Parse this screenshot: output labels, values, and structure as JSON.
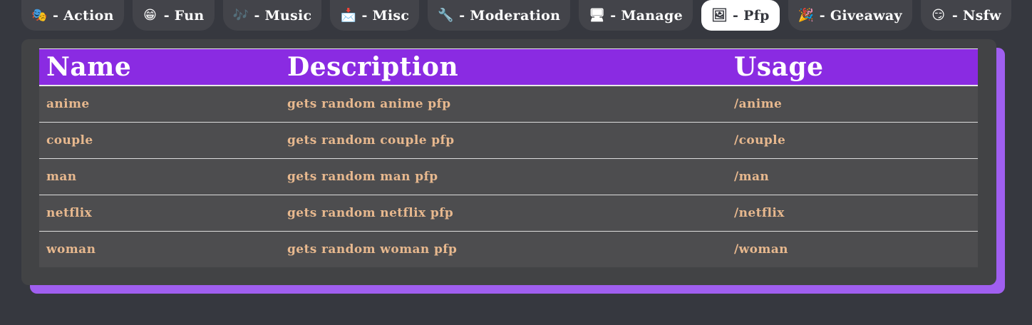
{
  "tabs": [
    {
      "icon": "🎭",
      "icon_name": "performing-arts-icon",
      "label": "- Action",
      "active": false
    },
    {
      "icon": "😁",
      "icon_name": "grinning-face-icon",
      "label": "- Fun",
      "active": false
    },
    {
      "icon": "🎶",
      "icon_name": "music-notes-icon",
      "label": "- Music",
      "active": false
    },
    {
      "icon": "📩",
      "icon_name": "envelope-arrow-icon",
      "label": "- Misc",
      "active": false
    },
    {
      "icon": "🔧",
      "icon_name": "wrench-icon",
      "label": "- Moderation",
      "active": false
    },
    {
      "icon": "🖥",
      "icon_name": "monitor-icon",
      "label": "- Manage",
      "active": false
    },
    {
      "icon": "🖼",
      "icon_name": "framed-picture-icon",
      "label": "- Pfp",
      "active": true
    },
    {
      "icon": "🎉",
      "icon_name": "party-popper-icon",
      "label": "- Giveaway",
      "active": false
    },
    {
      "icon": "😏",
      "icon_name": "smirking-face-icon",
      "label": "- Nsfw",
      "active": false
    }
  ],
  "table": {
    "headers": {
      "name": "Name",
      "description": "Description",
      "usage": "Usage"
    },
    "rows": [
      {
        "name": "anime",
        "description": "gets random anime pfp",
        "usage": "/anime"
      },
      {
        "name": "couple",
        "description": "gets random couple pfp",
        "usage": "/couple"
      },
      {
        "name": "man",
        "description": "gets random man pfp",
        "usage": "/man"
      },
      {
        "name": "netflix",
        "description": "gets random netflix pfp",
        "usage": "/netflix"
      },
      {
        "name": "woman",
        "description": "gets random woman pfp",
        "usage": "/woman"
      }
    ]
  },
  "colors": {
    "background": "#36383f",
    "tab_bg": "#43444a",
    "accent_purple": "#8a2be2",
    "shadow_purple": "#a05ff0",
    "row_text": "#e7b88e"
  }
}
